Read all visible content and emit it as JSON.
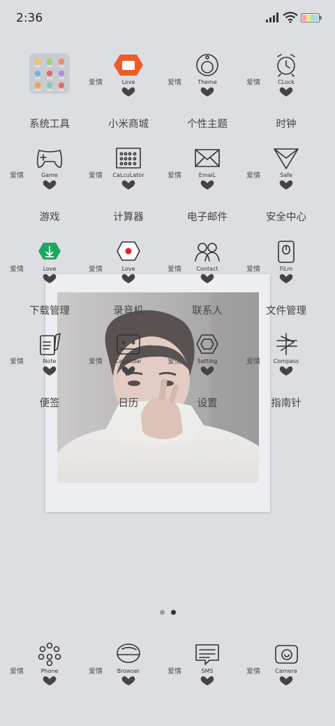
{
  "status_bar": {
    "time": "2:36",
    "icons": [
      "signal-icon",
      "wifi-icon",
      "battery-icon"
    ]
  },
  "photo_frame": {
    "subject": "photo"
  },
  "icons": [
    {
      "id": "system-tools",
      "label": "系统工具",
      "tag": "",
      "icon": "folder-icon"
    },
    {
      "id": "mi-store",
      "label": "小米商城",
      "tag": "Love",
      "icon": "mi-store-icon"
    },
    {
      "id": "theme",
      "label": "个性主题",
      "tag": "Theme",
      "icon": "theme-icon"
    },
    {
      "id": "clock",
      "label": "时钟",
      "tag": "CLock",
      "icon": "alarm-clock-icon"
    },
    {
      "id": "game",
      "label": "游戏",
      "tag": "Game",
      "icon": "gamepad-icon"
    },
    {
      "id": "calculator",
      "label": "计算器",
      "tag": "CaLcuLator",
      "icon": "calculator-icon"
    },
    {
      "id": "email",
      "label": "电子邮件",
      "tag": "EmaiL",
      "icon": "envelope-icon"
    },
    {
      "id": "security",
      "label": "安全中心",
      "tag": "Safe",
      "icon": "shield-icon"
    },
    {
      "id": "downloads",
      "label": "下载管理",
      "tag": "Love",
      "icon": "download-icon"
    },
    {
      "id": "recorder",
      "label": "录音机",
      "tag": "Love",
      "icon": "record-icon"
    },
    {
      "id": "contacts",
      "label": "联系人",
      "tag": "Contact",
      "icon": "contacts-icon"
    },
    {
      "id": "file-manager",
      "label": "文件管理",
      "tag": "FiLm",
      "icon": "file-manager-icon"
    },
    {
      "id": "notes",
      "label": "便签",
      "tag": "Note",
      "icon": "note-icon"
    },
    {
      "id": "calendar",
      "label": "日历",
      "tag": "CaLendar",
      "icon": "calendar-icon"
    },
    {
      "id": "settings",
      "label": "设置",
      "tag": "Setting",
      "icon": "gear-icon"
    },
    {
      "id": "compass",
      "label": "指南针",
      "tag": "Compass",
      "icon": "compass-icon"
    }
  ],
  "dock": [
    {
      "id": "phone",
      "tag": "Phone",
      "icon": "phone-icon"
    },
    {
      "id": "browser",
      "tag": "Browser",
      "icon": "browser-icon"
    },
    {
      "id": "sms",
      "tag": "SMS",
      "icon": "sms-icon"
    },
    {
      "id": "camera",
      "tag": "Camera",
      "icon": "camera-icon"
    }
  ],
  "deco": {
    "love_glyph": "爱情"
  },
  "page_dots": {
    "count": 2,
    "active": 1
  },
  "colors": {
    "background": "#dcdee2",
    "mi_orange": "#f05a28",
    "download_green": "#1aa860",
    "record_red": "#e52222"
  }
}
